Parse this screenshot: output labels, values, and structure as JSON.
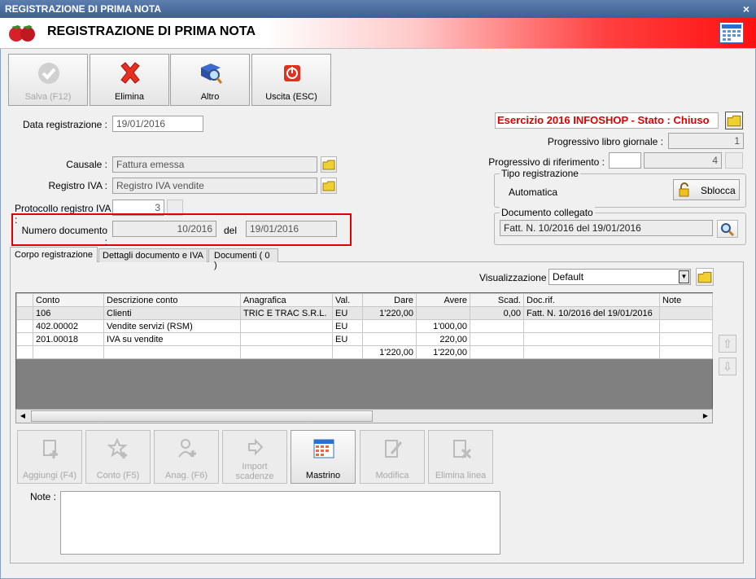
{
  "window": {
    "title": "REGISTRAZIONE DI PRIMA NOTA",
    "close": "×"
  },
  "header": {
    "title": "REGISTRAZIONE DI PRIMA NOTA"
  },
  "toolbar": {
    "save": "Salva (F12)",
    "delete": "Elimina",
    "other": "Altro",
    "exit": "Uscita (ESC)"
  },
  "form": {
    "data_reg_label": "Data registrazione :",
    "data_reg_value": "19/01/2016",
    "causale_label": "Causale :",
    "causale_value": "Fattura emessa",
    "registro_label": "Registro IVA :",
    "registro_value": "Registro IVA vendite",
    "protocollo_label": "Protocollo registro IVA :",
    "protocollo_value": "3",
    "numdoc_label": "Numero documento :",
    "numdoc_value": "10/2016",
    "del_label": "del",
    "del_value": "19/01/2016"
  },
  "right": {
    "esercizio": "Esercizio 2016 INFOSHOP - Stato : Chiuso",
    "prog_libro_label": "Progressivo libro giornale :",
    "prog_libro_value": "1",
    "prog_rif_label": "Progressivo di riferimento :",
    "prog_rif_value": "4",
    "tipo_title": "Tipo registrazione",
    "tipo_value": "Automatica",
    "sblocca": "Sblocca",
    "doc_title": "Documento collegato",
    "doc_value": "Fatt. N. 10/2016 del 19/01/2016"
  },
  "tabs": [
    "Corpo registrazione",
    "Dettagli documento e IVA",
    "Documenti ( 0 )"
  ],
  "view": {
    "label": "Visualizzazione :",
    "value": "Default"
  },
  "grid": {
    "columns": [
      "Conto",
      "Descrizione conto",
      "Anagrafica",
      "Val.",
      "Dare",
      "Avere",
      "Scad.",
      "Doc.rif.",
      "Note"
    ],
    "rows": [
      [
        "106",
        "Clienti",
        "TRIC E TRAC S.R.L.",
        "EU",
        "1'220,00",
        "",
        "0,00",
        "Fatt. N. 10/2016 del 19/01/2016",
        ""
      ],
      [
        "402.00002",
        "Vendite servizi (RSM)",
        "",
        "EU",
        "",
        "1'000,00",
        "",
        "",
        ""
      ],
      [
        "201.00018",
        "IVA su vendite",
        "",
        "EU",
        "",
        "220,00",
        "",
        "",
        ""
      ]
    ],
    "totals": [
      "",
      "",
      "",
      "",
      "1'220,00",
      "1'220,00",
      "",
      "",
      ""
    ]
  },
  "bottom_buttons": {
    "add": "Aggiungi (F4)",
    "account": "Conto (F5)",
    "anag": "Anag. (F6)",
    "import": "Import scadenze",
    "mastrino": "Mastrino",
    "edit": "Modifica",
    "delete_line": "Elimina linea"
  },
  "note_label": "Note :",
  "colors": {
    "accent_red": "#e00000",
    "title_blue": "#4a6ea0"
  }
}
